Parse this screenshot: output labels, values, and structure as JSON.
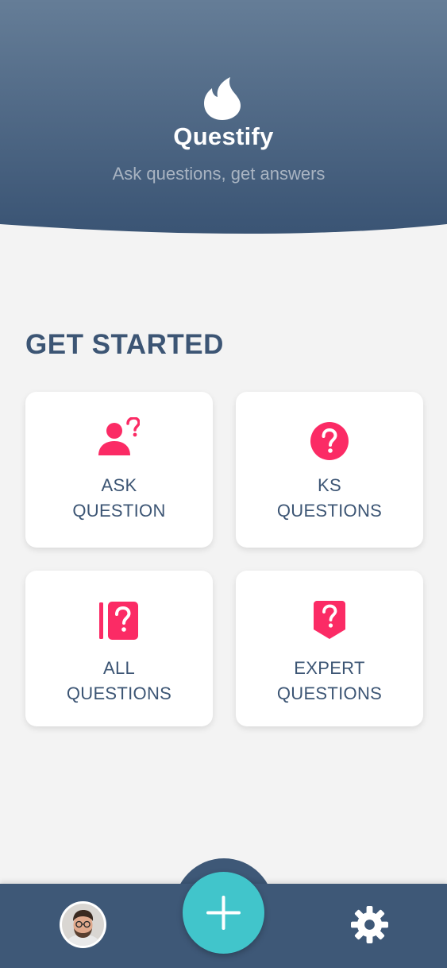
{
  "header": {
    "title": "Questify",
    "subtitle": "Ask questions, get answers",
    "logo_icon": "flame-icon"
  },
  "main": {
    "section_title": "GET STARTED",
    "cards": [
      {
        "line1": "ASK",
        "line2": "QUESTION",
        "icon": "user-question-icon"
      },
      {
        "line1": "KS",
        "line2": "QUESTIONS",
        "icon": "question-circle-icon"
      },
      {
        "line1": "ALL",
        "line2": "QUESTIONS",
        "icon": "question-book-icon"
      },
      {
        "line1": "EXPERT",
        "line2": "QUESTIONS",
        "icon": "question-badge-icon"
      }
    ]
  },
  "bottom_nav": {
    "left": "avatar",
    "center": "add-icon",
    "right": "gear-icon"
  },
  "colors": {
    "header_top": "#657d97",
    "header_bottom": "#3d5676",
    "accent": "#fb2b65",
    "fab": "#41c5cb",
    "nav": "#3e5877",
    "text": "#3c5574"
  }
}
